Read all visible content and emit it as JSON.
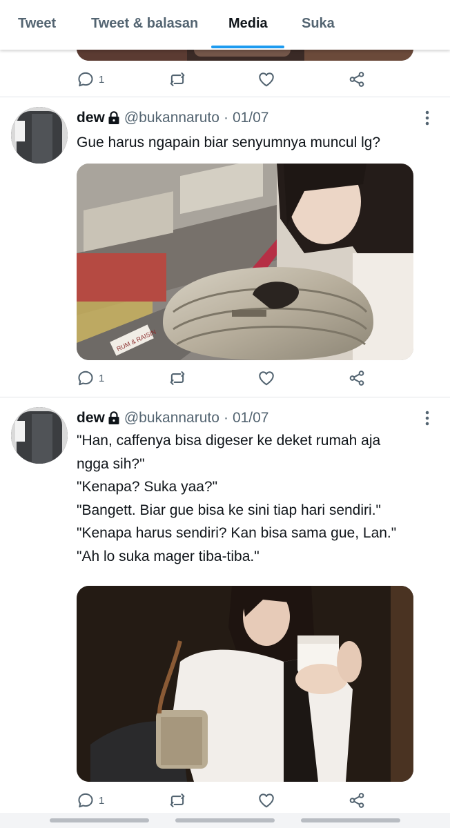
{
  "tabs": [
    {
      "label": "Tweet"
    },
    {
      "label": "Tweet & balasan"
    },
    {
      "label": "Media"
    },
    {
      "label": "Suka"
    }
  ],
  "active_tab": "Media",
  "top_actions": {
    "reply_count": "1"
  },
  "tweets": [
    {
      "name": "dew",
      "handle": "@bukannaruto",
      "separator": "·",
      "date": "01/07",
      "text_lines": [
        "Gue harus ngapain biar senyumnya muncul lg?"
      ],
      "reply_count": "1"
    },
    {
      "name": "dew",
      "handle": "@bukannaruto",
      "separator": "·",
      "date": "01/07",
      "text_lines": [
        "\"Han, caffenya bisa digeser ke deket rumah aja",
        "ngga sih?\"",
        "\"Kenapa? Suka yaa?\"",
        "\"Bangett. Biar gue bisa ke sini tiap hari sendiri.\"",
        "\"Kenapa harus sendiri? Kan bisa sama gue, Lan.\"",
        "\"Ah lo suka mager tiba-tiba.\""
      ],
      "reply_count": "1"
    }
  ],
  "photo_labels": {
    "tag": "RUM & RAISIN"
  },
  "icons": [
    "reply-icon",
    "retweet-icon",
    "like-icon",
    "share-icon",
    "lock-icon",
    "more-icon"
  ],
  "colors": {
    "accent": "#1d9bf0",
    "muted": "#536471",
    "text": "#0f1419"
  }
}
